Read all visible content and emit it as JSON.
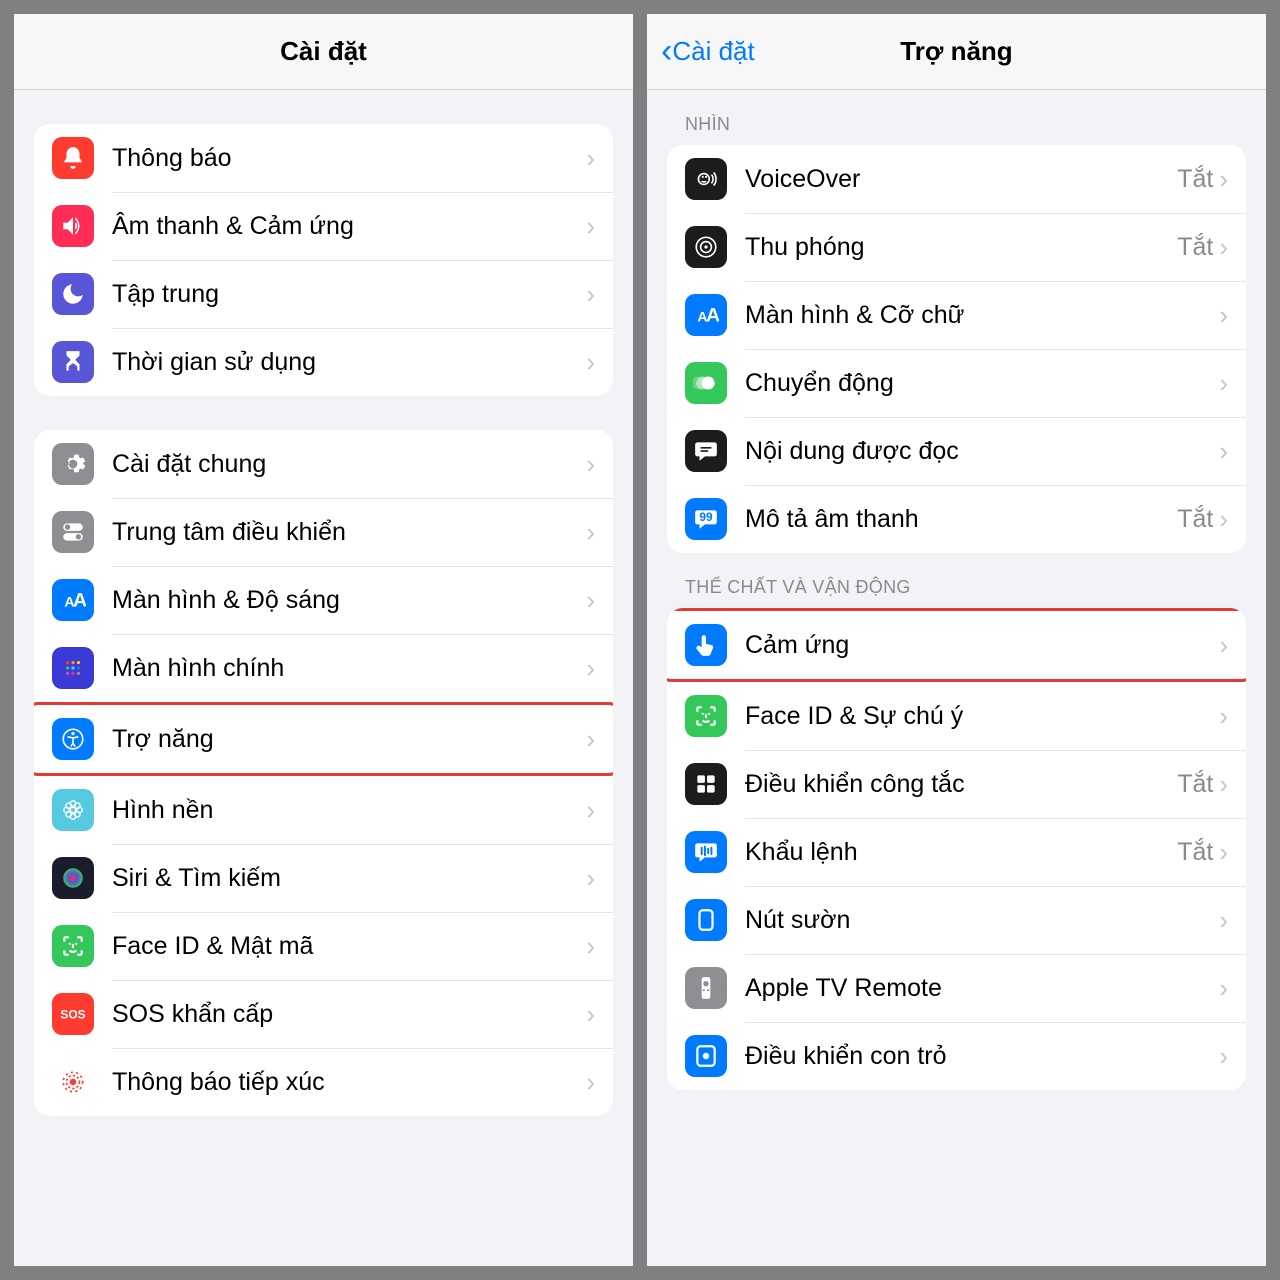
{
  "left": {
    "title": "Cài đặt",
    "groups": [
      {
        "rows": [
          {
            "key": "notifications",
            "label": "Thông báo",
            "icon": "bell-icon",
            "bg": "#ff3b30"
          },
          {
            "key": "sounds",
            "label": "Âm thanh & Cảm ứng",
            "icon": "speaker-icon",
            "bg": "#ff2d55"
          },
          {
            "key": "focus",
            "label": "Tập trung",
            "icon": "moon-icon",
            "bg": "#5856d6"
          },
          {
            "key": "screentime",
            "label": "Thời gian sử dụng",
            "icon": "hourglass-icon",
            "bg": "#5856d6"
          }
        ]
      },
      {
        "rows": [
          {
            "key": "general",
            "label": "Cài đặt chung",
            "icon": "gear-icon",
            "bg": "#8e8e93"
          },
          {
            "key": "control-center",
            "label": "Trung tâm điều khiển",
            "icon": "switches-icon",
            "bg": "#8e8e93"
          },
          {
            "key": "display",
            "label": "Màn hình & Độ sáng",
            "icon": "aa-icon",
            "bg": "#007aff"
          },
          {
            "key": "home-screen",
            "label": "Màn hình chính",
            "icon": "grid-icon",
            "bg": "#3a3ad6"
          },
          {
            "key": "accessibility",
            "label": "Trợ năng",
            "icon": "access-icon",
            "bg": "#007aff",
            "highlight": true
          },
          {
            "key": "wallpaper",
            "label": "Hình nền",
            "icon": "flower-icon",
            "bg": "#55c9e0"
          },
          {
            "key": "siri",
            "label": "Siri & Tìm kiếm",
            "icon": "siri-icon",
            "bg": "#1b1b2e"
          },
          {
            "key": "faceid",
            "label": "Face ID & Mật mã",
            "icon": "faceid-icon",
            "bg": "#34c759"
          },
          {
            "key": "sos",
            "label": "SOS khẩn cấp",
            "icon": "sos-icon",
            "bg": "#ff3b30"
          },
          {
            "key": "exposure",
            "label": "Thông báo tiếp xúc",
            "icon": "exposure-icon",
            "bg": "#ffffff"
          }
        ]
      }
    ]
  },
  "right": {
    "back_label": "Cài đặt",
    "title": "Trợ năng",
    "sections": [
      {
        "header": "NHÌN",
        "rows": [
          {
            "key": "voiceover",
            "label": "VoiceOver",
            "status": "Tắt",
            "icon": "voiceover-icon",
            "bg": "#1c1c1e"
          },
          {
            "key": "zoom",
            "label": "Thu phóng",
            "status": "Tắt",
            "icon": "zoom-icon",
            "bg": "#1c1c1e"
          },
          {
            "key": "display-text",
            "label": "Màn hình & Cỡ chữ",
            "icon": "aa-icon",
            "bg": "#007aff"
          },
          {
            "key": "motion",
            "label": "Chuyển động",
            "icon": "motion-icon",
            "bg": "#34c759"
          },
          {
            "key": "spoken",
            "label": "Nội dung được đọc",
            "icon": "speech-icon",
            "bg": "#1c1c1e"
          },
          {
            "key": "audio-desc",
            "label": "Mô tả âm thanh",
            "status": "Tắt",
            "icon": "quote-icon",
            "bg": "#007aff"
          }
        ]
      },
      {
        "header": "THỂ CHẤT VÀ VẬN ĐỘNG",
        "rows": [
          {
            "key": "touch",
            "label": "Cảm ứng",
            "icon": "touch-icon",
            "bg": "#007aff",
            "highlight": true
          },
          {
            "key": "faceid-attn",
            "label": "Face ID & Sự chú ý",
            "icon": "faceid-icon",
            "bg": "#34c759"
          },
          {
            "key": "switch-control",
            "label": "Điều khiển công tắc",
            "status": "Tắt",
            "icon": "switch-ctrl-icon",
            "bg": "#1c1c1e"
          },
          {
            "key": "voice-control",
            "label": "Khẩu lệnh",
            "status": "Tắt",
            "icon": "voice-ctrl-icon",
            "bg": "#007aff"
          },
          {
            "key": "side-button",
            "label": "Nút sườn",
            "icon": "side-btn-icon",
            "bg": "#007aff"
          },
          {
            "key": "apple-tv",
            "label": "Apple TV Remote",
            "icon": "remote-icon",
            "bg": "#8e8e93"
          },
          {
            "key": "pointer",
            "label": "Điều khiển con trỏ",
            "icon": "pointer-icon",
            "bg": "#007aff"
          }
        ]
      }
    ]
  },
  "icons": {
    "bell-icon": "<svg viewBox='0 0 24 24' fill='white'><path d='M12 2a6 6 0 016 6v4l2 3v1H4v-1l2-3V8a6 6 0 016-6zm0 20a2.5 2.5 0 002.5-2.5h-5A2.5 2.5 0 0012 22z'/></svg>",
    "speaker-icon": "<svg viewBox='0 0 24 24' fill='white'><path d='M3 9v6h4l5 5V4L7 9H3zm13 3a4 4 0 00-2-3.5v7A4 4 0 0016 12zm-2-8v2a8 8 0 010 12v2a10 10 0 000-16z'/></svg>",
    "moon-icon": "<svg viewBox='0 0 24 24' fill='white'><path d='M21 12.8A9 9 0 1111.2 3a7 7 0 009.8 9.8z'/></svg>",
    "hourglass-icon": "<svg viewBox='0 0 24 24' fill='white'><path d='M6 2h12v4l-4 4 4 4v6H6v-6l4-4-4-4V2zm2 14v4h8v-4l-4-3-4 3z'/></svg>",
    "gear-icon": "<svg viewBox='0 0 24 24' fill='white'><path d='M12 8a4 4 0 100 8 4 4 0 000-8zm9.4 4l2 1.6-2 3.4-2.4-.7a8 8 0 01-1.4.8l-.4 2.5h-4l-.4-2.5a8 8 0 01-1.4-.8l-2.4.7-2-3.4 2-1.6v-1l-2-1.6 2-3.4 2.4.7a8 8 0 011.4-.8l.4-2.5h4l.4 2.5a8 8 0 011.4.8l2.4-.7 2 3.4-2 1.6v1z'/></svg>",
    "switches-icon": "<svg viewBox='0 0 24 24' fill='white'><rect x='3' y='4' width='18' height='7' rx='3.5' fill='white'/><circle cx='7' cy='7.5' r='2.5' fill='#8e8e93'/><rect x='3' y='13' width='18' height='7' rx='3.5' fill='white'/><circle cx='17' cy='16.5' r='2.5' fill='#8e8e93'/></svg>",
    "aa-icon": "<svg viewBox='0 0 24 24'><text x='4' y='18' font-size='13' font-weight='700' fill='white'>A</text><text x='12' y='18' font-size='18' font-weight='700' fill='white'>A</text></svg>",
    "grid-icon": "<svg viewBox='0 0 24 24'><rect x='2' y='2' width='20' height='20' rx='4' fill='#3a3ad6'/><circle cx='7' cy='7' r='1.5' fill='#ff3b30'/><circle cx='12' cy='7' r='1.5' fill='#ff9500'/><circle cx='17' cy='7' r='1.5' fill='#ffcc00'/><circle cx='7' cy='12' r='1.5' fill='#34c759'/><circle cx='12' cy='12' r='1.5' fill='#5ac8fa'/><circle cx='17' cy='12' r='1.5' fill='#007aff'/><circle cx='7' cy='17' r='1.5' fill='#af52de'/><circle cx='12' cy='17' r='1.5' fill='#ff2d55'/><circle cx='17' cy='17' r='1.5' fill='#8e8e93'/></svg>",
    "access-icon": "<svg viewBox='0 0 24 24' fill='none' stroke='white' stroke-width='1.5'><circle cx='12' cy='12' r='9'/><circle cx='12' cy='7' r='1.5' fill='white' stroke='none'/><path d='M7 10l5 1 5-1M12 11v5m-2 3l2-3 2 3' stroke='white'/></svg>",
    "flower-icon": "<svg viewBox='0 0 24 24' fill='none' stroke='white' stroke-width='1.3'><circle cx='12' cy='12' r='2.5'/><circle cx='12' cy='6' r='2.5'/><circle cx='12' cy='18' r='2.5'/><circle cx='6' cy='12' r='2.5'/><circle cx='18' cy='12' r='2.5'/><circle cx='8' cy='8' r='2.5'/><circle cx='16' cy='8' r='2.5'/><circle cx='8' cy='16' r='2.5'/><circle cx='16' cy='16' r='2.5'/></svg>",
    "siri-icon": "<svg viewBox='0 0 24 24'><defs><radialGradient id='sg'><stop offset='0' stop-color='#ff2d55'/><stop offset='.5' stop-color='#5856d6'/><stop offset='1' stop-color='#34c759'/></radialGradient></defs><circle cx='12' cy='12' r='9' fill='url(#sg)'/></svg>",
    "faceid-icon": "<svg viewBox='0 0 24 24' fill='none' stroke='white' stroke-width='2'><path d='M4 8V5a1 1 0 011-1h3M20 8V5a1 1 0 00-1-1h-3M4 16v3a1 1 0 001 1h3M20 16v3a1 1 0 01-1 1h-3'/><circle cx='9' cy='10' r='1' fill='white' stroke='none'/><circle cx='15' cy='10' r='1' fill='white' stroke='none'/><path d='M12 10v3h-1M9 16c1 1 2 1.5 3 1.5s2-.5 3-1.5'/></svg>",
    "sos-icon": "<svg viewBox='0 0 24 24'><text x='12' y='16' font-size='11' font-weight='800' fill='white' text-anchor='middle'>SOS</text></svg>",
    "exposure-icon": "<svg viewBox='0 0 24 24' fill='none' stroke='#ff3b30' stroke-width='1.5'><circle cx='12' cy='12' r='3' fill='#ff3b30' stroke='none'/><circle cx='12' cy='12' r='6' stroke-dasharray='2 2'/><circle cx='12' cy='12' r='9' stroke-dasharray='2 3'/></svg>",
    "voiceover-icon": "<svg viewBox='0 0 24 24' fill='none' stroke='white' stroke-width='1.5'><circle cx='10' cy='12' r='5'/><circle cx='9' cy='10' r='1' fill='white' stroke='none'/><circle cx='12' cy='10' r='1' fill='white' stroke='none'/><path d='M8 14c1 1 3 1 4 0M17 8c2 2 2 6 0 8M19 6c3 3 3 9 0 12'/></svg>",
    "zoom-icon": "<svg viewBox='0 0 24 24' fill='none' stroke='white' stroke-width='1.5'><circle cx='12' cy='12' r='9'/><circle cx='12' cy='12' r='5'/><circle cx='12' cy='12' r='1.5' fill='white' stroke='none'/></svg>",
    "motion-icon": "<svg viewBox='0 0 24 24' fill='none' stroke='white' stroke-width='1.5'><circle cx='14' cy='12' r='6' fill='white' stroke='none'/><circle cx='9' cy='12' r='6' opacity='.5' fill='white' stroke='none'/><circle cx='5' cy='12' r='6' opacity='.25' fill='white' stroke='none'/></svg>",
    "speech-icon": "<svg viewBox='0 0 24 24' fill='white'><path d='M4 4h16a2 2 0 012 2v9a2 2 0 01-2 2h-9l-5 4v-4H4a2 2 0 01-2-2V6a2 2 0 012-2z'/><path d='M7 9h10M7 12h7' stroke='#1c1c1e' stroke-width='1.5'/></svg>",
    "quote-icon": "<svg viewBox='0 0 24 24' fill='white'><path d='M4 4h16a2 2 0 012 2v9a2 2 0 01-2 2h-9l-5 4v-4H4a2 2 0 01-2-2V6a2 2 0 012-2z'/><text x='12' y='14' font-size='11' font-weight='800' fill='#007aff' text-anchor='middle'>99</text></svg>",
    "touch-icon": "<svg viewBox='0 0 24 24' fill='white'><path d='M10 3a2 2 0 012 2v6l5 1a2 2 0 011.5 2.7l-2 5A3 3 0 0113.7 22H10a3 3 0 01-2.3-1l-4-5a2 2 0 012.6-3L8 14V5a2 2 0 012-2z'/></svg>",
    "switch-ctrl-icon": "<svg viewBox='0 0 24 24' fill='white'><rect x='4' y='4' width='7' height='7' rx='1.5'/><rect x='13' y='4' width='7' height='7' rx='1.5'/><rect x='4' y='13' width='7' height='7' rx='1.5'/><rect x='13' y='13' width='7' height='7' rx='1.5'/></svg>",
    "voice-ctrl-icon": "<svg viewBox='0 0 24 24' fill='white'><path d='M4 4h16a2 2 0 012 2v9a2 2 0 01-2 2h-9l-5 4v-4H4a2 2 0 01-2-2V6a2 2 0 012-2z'/><path d='M8 8v6M11 7v8M14 9v4M17 8v6' stroke='#007aff' stroke-width='1.8' stroke-linecap='round'/></svg>",
    "side-btn-icon": "<svg viewBox='0 0 24 24' fill='white'><rect x='6' y='3' width='12' height='18' rx='3' fill='none' stroke='white' stroke-width='2'/><rect x='17' y='7' width='2' height='5' rx='1'/></svg>",
    "remote-icon": "<svg viewBox='0 0 24 24' fill='white'><rect x='8' y='2' width='8' height='20' rx='2'/><circle cx='12' cy='8' r='2.5' fill='#8e8e93'/><circle cx='10' cy='14' r='1' fill='#8e8e93'/><circle cx='14' cy='14' r='1' fill='#8e8e93'/></svg>",
    "pointer-icon": "<svg viewBox='0 0 24 24' fill='none' stroke='white' stroke-width='2'><rect x='4' y='3' width='16' height='18' rx='3'/><circle cx='12' cy='12' r='3' fill='white' stroke='none'/></svg>"
  }
}
